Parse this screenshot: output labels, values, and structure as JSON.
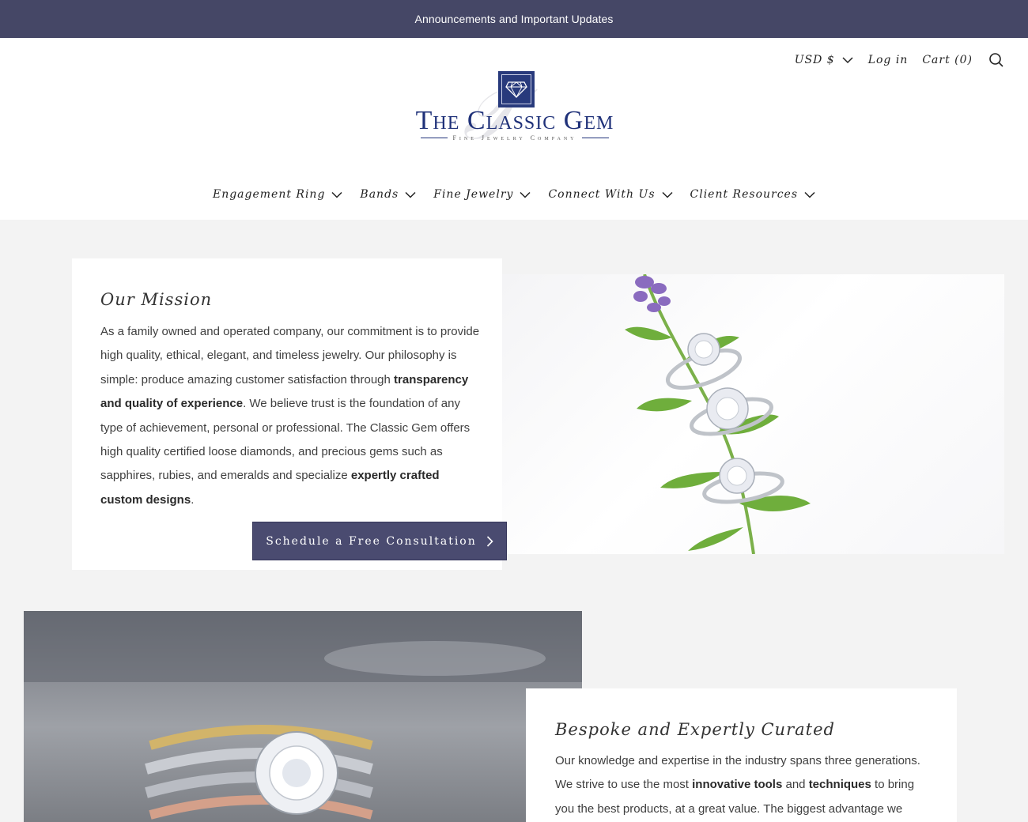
{
  "announcement": "Announcements and Important Updates",
  "utility": {
    "currency": "USD $",
    "login": "Log in",
    "cart": "Cart (0)"
  },
  "logo": {
    "name": "The Classic Gem",
    "tagline": "Fine Jewelry Company"
  },
  "nav": [
    {
      "label": "Engagement Ring"
    },
    {
      "label": "Bands"
    },
    {
      "label": "Fine Jewelry"
    },
    {
      "label": "Connect With Us"
    },
    {
      "label": "Client Resources"
    }
  ],
  "mission": {
    "title": "Our Mission",
    "p1": "As a family owned and operated company, our commitment is to provide high quality, ethical, elegant, and timeless jewelry. Our philosophy is simple: produce amazing customer satisfaction through ",
    "b1": "transparency and quality of experience",
    "p2": ". We believe trust is the foundation of any type of achievement, personal or professional. The Classic Gem offers high quality certified loose diamonds, and precious gems such as sapphires, rubies, and emeralds and specialize ",
    "b2": "expertly crafted custom designs",
    "p3": ".",
    "cta": "Schedule a Free Consultation"
  },
  "bespoke": {
    "title": "Bespoke and Expertly Curated",
    "p1": "Our knowledge and expertise in the industry spans three generations. We strive to use the most ",
    "b1": "innovative tools",
    "p2": " and ",
    "b2": "techniques",
    "p3": " to bring you the best products, at a great value. The biggest advantage we"
  },
  "colors": {
    "brand_navy": "#283a7c",
    "announce_bar": "#454766",
    "cta": "#4a4b70"
  }
}
